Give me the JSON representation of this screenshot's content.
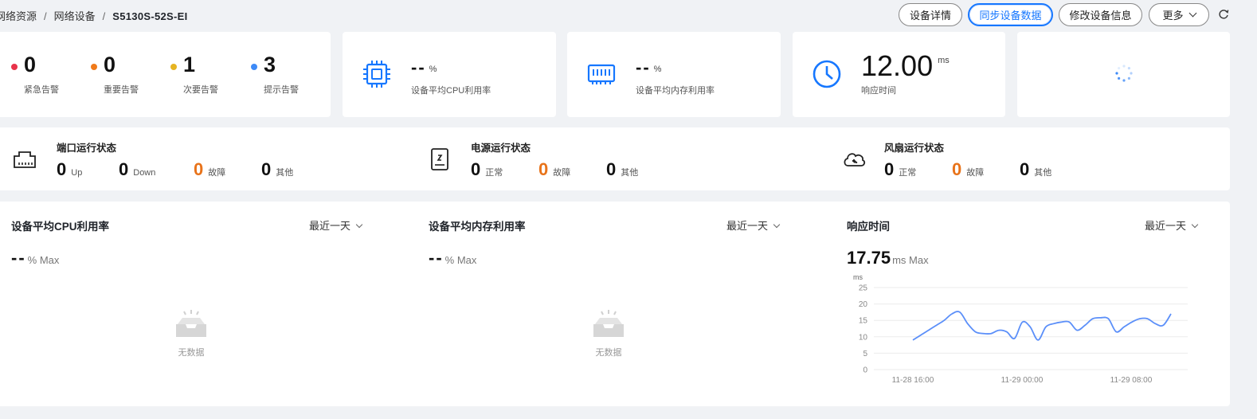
{
  "breadcrumb": {
    "items": [
      "网络资源",
      "网络设备"
    ],
    "current": "S5130S-52S-EI"
  },
  "header_buttons": {
    "details": "设备详情",
    "sync": "同步设备数据",
    "modify": "修改设备信息",
    "more": "更多"
  },
  "alarms": [
    {
      "count": "0",
      "label": "紧急告警",
      "color": "#e8334a"
    },
    {
      "count": "0",
      "label": "重要告警",
      "color": "#f07a1a"
    },
    {
      "count": "1",
      "label": "次要告警",
      "color": "#e6b422"
    },
    {
      "count": "3",
      "label": "提示告警",
      "color": "#3d8af7"
    }
  ],
  "metrics": {
    "cpu": {
      "value": "--",
      "unit": "%",
      "label": "设备平均CPU利用率"
    },
    "memory": {
      "value": "--",
      "unit": "%",
      "label": "设备平均内存利用率"
    },
    "response": {
      "value": "12.00",
      "unit": "ms",
      "label": "响应时间"
    }
  },
  "status": {
    "port": {
      "title": "端口运行状态",
      "stats": [
        {
          "n": "0",
          "t": "Up"
        },
        {
          "n": "0",
          "t": "Down"
        },
        {
          "n": "0",
          "t": "故障"
        },
        {
          "n": "0",
          "t": "其他"
        }
      ]
    },
    "power": {
      "title": "电源运行状态",
      "stats": [
        {
          "n": "0",
          "t": "正常"
        },
        {
          "n": "0",
          "t": "故障"
        },
        {
          "n": "0",
          "t": "其他"
        }
      ]
    },
    "fan": {
      "title": "风扇运行状态",
      "stats": [
        {
          "n": "0",
          "t": "正常"
        },
        {
          "n": "0",
          "t": "故障"
        },
        {
          "n": "0",
          "t": "其他"
        }
      ]
    }
  },
  "panels": {
    "cpu": {
      "title": "设备平均CPU利用率",
      "range": "最近一天",
      "max": "--",
      "max_unit": "% Max",
      "empty": "无数据"
    },
    "memory": {
      "title": "设备平均内存利用率",
      "range": "最近一天",
      "max": "--",
      "max_unit": "% Max",
      "empty": "无数据"
    },
    "response": {
      "title": "响应时间",
      "range": "最近一天",
      "max": "17.75",
      "max_unit": "ms Max"
    }
  },
  "chart_data": {
    "type": "line",
    "title": "",
    "ylabel": "ms",
    "xlabel": "",
    "ylim": [
      0,
      25
    ],
    "yticks": [
      "0",
      "5",
      "10",
      "15",
      "20",
      "25"
    ],
    "xtick_labels": [
      "11-28 16:00",
      "11-29 00:00",
      "11-29 08:00"
    ],
    "grid": true,
    "series": [
      {
        "color": "#5b8ff9",
        "values": [
          9,
          10.5,
          12,
          13.5,
          15,
          17,
          17.5,
          14,
          11.5,
          11,
          11,
          12,
          11.5,
          9.5,
          14.5,
          13,
          9,
          13,
          14,
          14.5,
          14.5,
          12,
          13.5,
          15.5,
          15.8,
          15.5,
          11.5,
          13,
          14.5,
          15.5,
          15.5,
          14,
          13.5,
          17
        ]
      }
    ]
  }
}
